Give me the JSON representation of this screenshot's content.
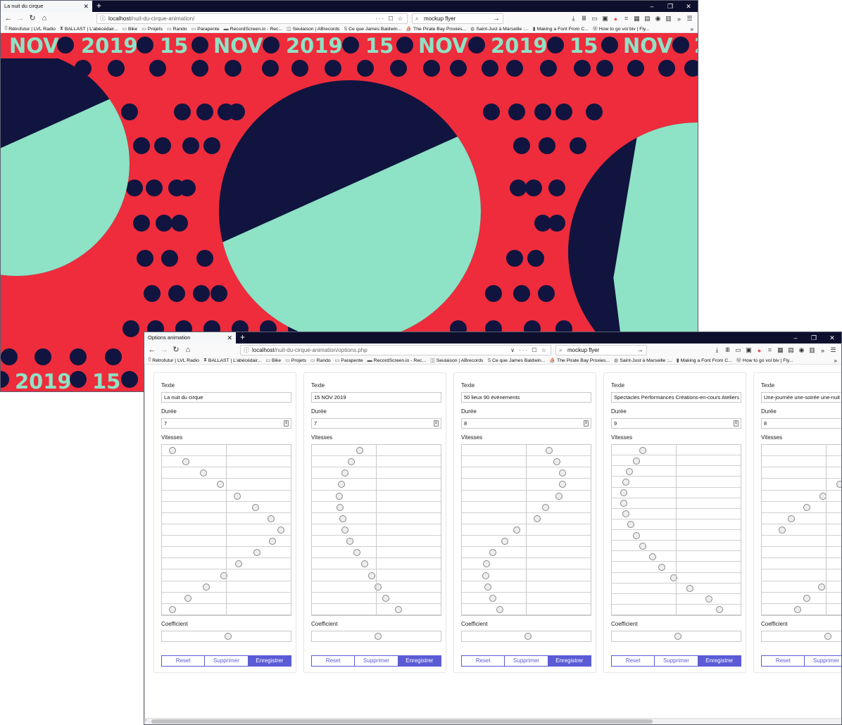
{
  "colors": {
    "red": "#ee2c3c",
    "navy": "#10143f",
    "mint": "#8ee2c5",
    "accent": "#5b5bd6"
  },
  "window_controls": [
    "–",
    "❐",
    "✕"
  ],
  "bookmarks": [
    {
      "label": "Rétrofutur | LVL Radio",
      "icon": "lvl-radio-icon"
    },
    {
      "label": "BALLAST | L'abécédair...",
      "icon": "hourglass-icon"
    },
    {
      "label": "Bike",
      "icon": "folder-icon"
    },
    {
      "label": "Projets",
      "icon": "folder-icon"
    },
    {
      "label": "Rando",
      "icon": "folder-icon"
    },
    {
      "label": "Parapente",
      "icon": "folder-icon"
    },
    {
      "label": "RecordScreen.io - Rec...",
      "icon": "screen-icon"
    },
    {
      "label": "Seulaison | ABrecords",
      "icon": "seulaison-icon"
    },
    {
      "label": "Ce que James Baldwin...",
      "icon": "s-icon"
    },
    {
      "label": "The Pirate Bay Proxies...",
      "icon": "pirate-ship-icon"
    },
    {
      "label": "Saint-Just à Marseille :...",
      "icon": "globe-icon"
    },
    {
      "label": "Making a Font From C...",
      "icon": "book-icon"
    },
    {
      "label": "How to go vol biv | Fly...",
      "icon": "wordpress-icon"
    }
  ],
  "bookmarks_more": "»",
  "window1": {
    "tab_title": "La nuit du cirque",
    "url_host": "localhost",
    "url_path": "/nuit-du-cirque-animation/",
    "url_actions": "··· ☐ ☆",
    "search_value": "mockup flyer",
    "banner_top": [
      "NOV",
      "2019",
      "15",
      "NOV",
      "2019",
      "15",
      "NOV",
      "2019",
      "15",
      "NOV",
      "2"
    ],
    "banner_bottom": [
      "2019",
      "15"
    ]
  },
  "window2": {
    "tab_title": "Options animation",
    "url_host": "localhost",
    "url_path": "/nuit-du-cirque-animation/options.php",
    "url_actions": "∨ ··· ☐ ☆",
    "search_value": "mockup flyer",
    "labels": {
      "texte": "Texte",
      "duree": "Durée",
      "vitesses": "Vitesses",
      "coefficient": "Coefficient"
    },
    "buttons": {
      "reset": "Reset",
      "delete": "Supprimer",
      "save": "Enregistrer"
    },
    "cards": [
      {
        "texte": "La nuit du cirque",
        "duree": "7",
        "speeds": [
          0.04,
          0.15,
          0.3,
          0.44,
          0.58,
          0.73,
          0.86,
          0.94,
          0.87,
          0.74,
          0.59,
          0.47,
          0.32,
          0.17,
          0.04
        ],
        "coef": 0.5
      },
      {
        "texte": "15 NOV 2019",
        "duree": "7",
        "speeds": [
          0.35,
          0.28,
          0.23,
          0.2,
          0.18,
          0.19,
          0.21,
          0.23,
          0.27,
          0.33,
          0.39,
          0.45,
          0.5,
          0.57,
          0.67
        ],
        "coef": 0.5
      },
      {
        "texte": "50 lieux 90 évènements",
        "duree": "8",
        "speeds": [
          0.68,
          0.74,
          0.79,
          0.79,
          0.76,
          0.65,
          0.58,
          0.41,
          0.31,
          0.21,
          0.16,
          0.15,
          0.17,
          0.21,
          0.27
        ],
        "coef": 0.5
      },
      {
        "texte": "Spectacles Performances Créations-en-cours Ateliers",
        "duree": "9",
        "speeds": [
          0.21,
          0.16,
          0.1,
          0.07,
          0.05,
          0.05,
          0.07,
          0.11,
          0.16,
          0.21,
          0.29,
          0.37,
          0.47,
          0.6,
          0.76,
          0.85
        ],
        "coef": 0.5
      },
      {
        "texte": "Une-journée une-soirée une-nuit",
        "duree": "8",
        "speeds": [
          0.97,
          0.88,
          0.74,
          0.6,
          0.46,
          0.33,
          0.2,
          0.12,
          0.9,
          0.97,
          0.86,
          0.65,
          0.45,
          0.33,
          0.25
        ],
        "coef": 0.5
      }
    ]
  }
}
